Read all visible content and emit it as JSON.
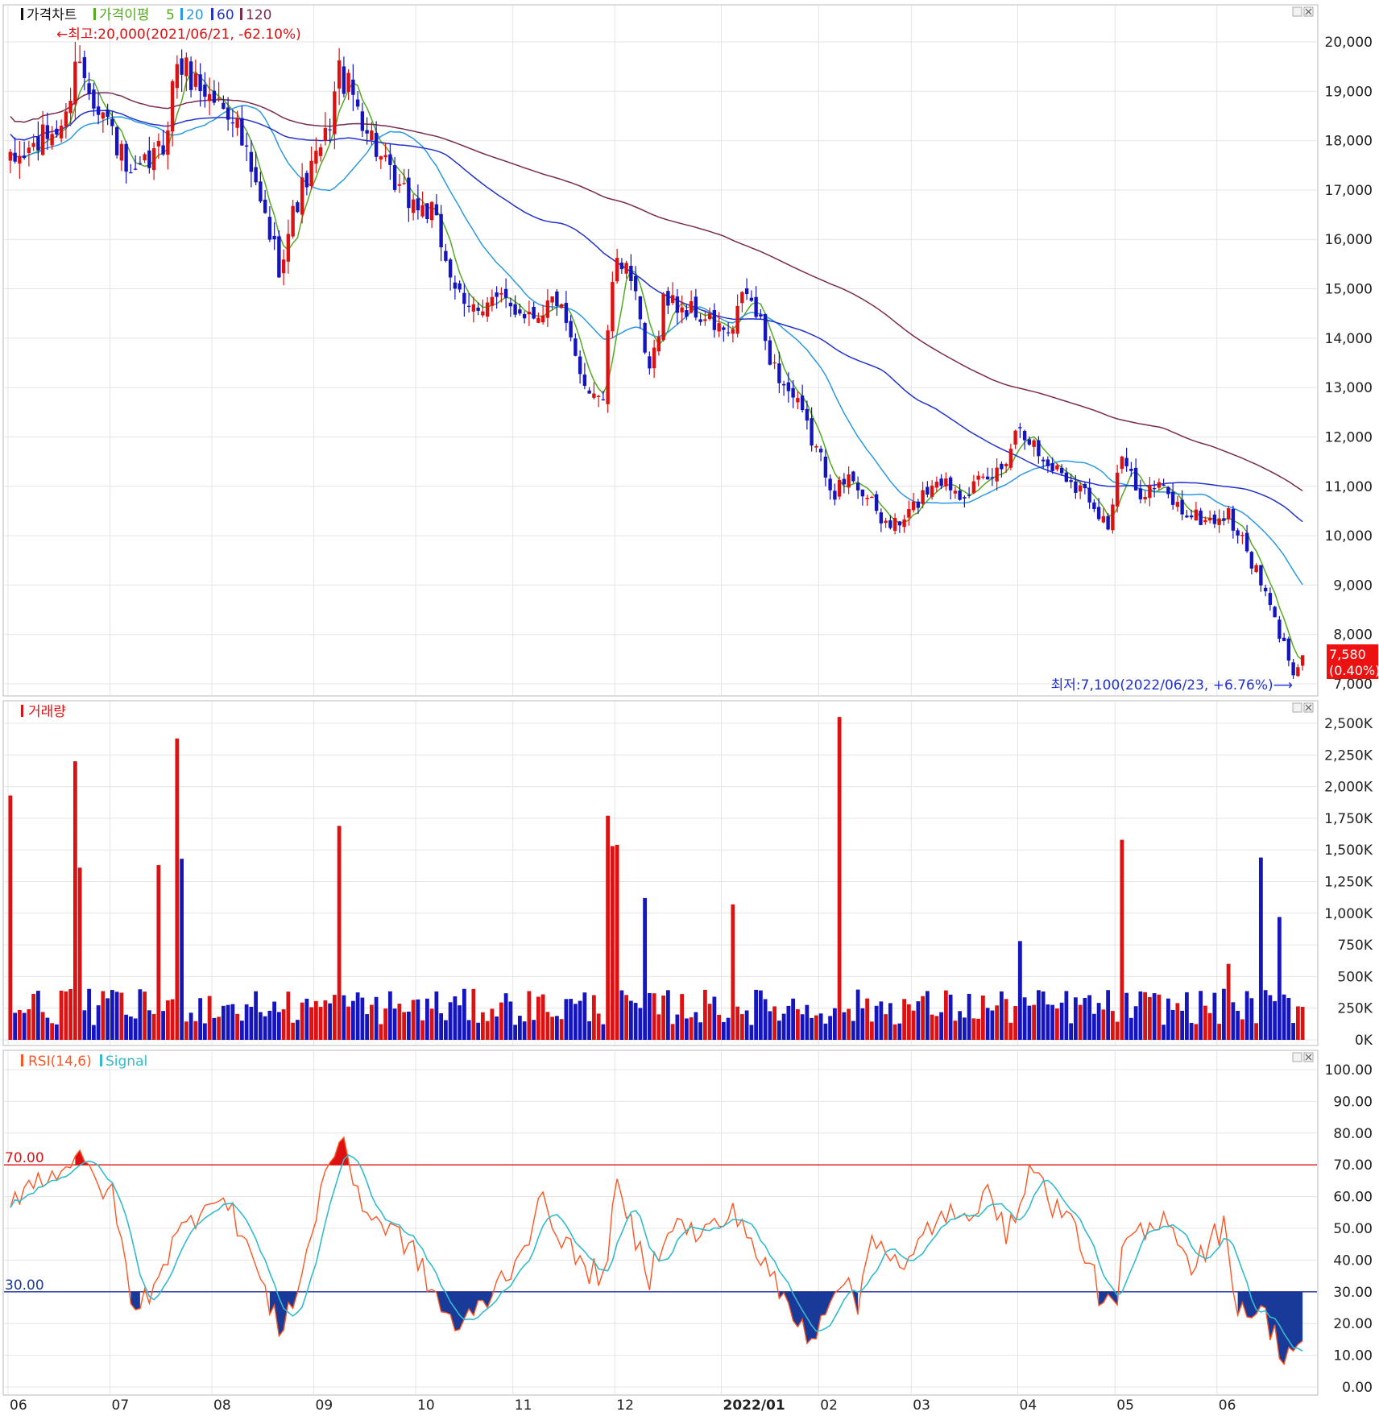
{
  "colors": {
    "up": "#dd1111",
    "down": "#1515c0",
    "ma5": "#55aa22",
    "ma20": "#2a9ae0",
    "ma60": "#2233cc",
    "ma120": "#7a2b4e",
    "rsi": "#ff5522",
    "signal": "#33bbcc",
    "overbought": "#dd1111",
    "oversold": "#1a3a9a",
    "grid": "#e4e4e4"
  },
  "price_panel": {
    "legend": {
      "title": "가격차트",
      "indicator": "가격이평",
      "ma5": "5",
      "ma20": "20",
      "ma60": "60",
      "ma120": "120"
    },
    "high_note": "←최고:20,000(2021/06/21, -62.10%)",
    "low_note": "최저:7,100(2022/06/23, +6.76%)⟶",
    "current_price": "7,580",
    "current_change": "(0.40%)"
  },
  "volume_panel": {
    "legend": "거래량"
  },
  "rsi_panel": {
    "legend_rsi": "RSI(14,6)",
    "legend_signal": "Signal",
    "level_high": "70.00",
    "level_low": "30.00"
  },
  "chart_data": [
    {
      "type": "candlestick",
      "panel": "price",
      "x_tick_labels": [
        "06",
        "07",
        "08",
        "09",
        "10",
        "11",
        "12",
        "2022/01",
        "02",
        "03",
        "04",
        "05",
        "06"
      ],
      "y_tick_labels": [
        "7,000",
        "8,000",
        "9,000",
        "10,000",
        "11,000",
        "12,000",
        "13,000",
        "14,000",
        "15,000",
        "16,000",
        "17,000",
        "18,000",
        "19,000",
        "20,000"
      ],
      "ylim": [
        6800,
        20600
      ],
      "session_count": 256,
      "ohlc_anchors": [
        {
          "date": "2021-06-01",
          "close": 17500
        },
        {
          "date": "2021-06-17",
          "close": 18400
        },
        {
          "date": "2021-06-21",
          "close": 19700
        },
        {
          "date": "2021-07-01",
          "close": 18200
        },
        {
          "date": "2021-07-07",
          "close": 17100
        },
        {
          "date": "2021-07-16",
          "close": 17900
        },
        {
          "date": "2021-07-21",
          "close": 19600
        },
        {
          "date": "2021-07-30",
          "close": 18900
        },
        {
          "date": "2021-08-06",
          "close": 18600
        },
        {
          "date": "2021-08-12",
          "close": 17300
        },
        {
          "date": "2021-08-20",
          "close": 15500
        },
        {
          "date": "2021-08-26",
          "close": 16800
        },
        {
          "date": "2021-09-03",
          "close": 18000
        },
        {
          "date": "2021-09-08",
          "close": 19400
        },
        {
          "date": "2021-09-14",
          "close": 18700
        },
        {
          "date": "2021-09-24",
          "close": 17000
        },
        {
          "date": "2021-10-06",
          "close": 16500
        },
        {
          "date": "2021-10-15",
          "close": 14500
        },
        {
          "date": "2021-10-22",
          "close": 14800
        },
        {
          "date": "2021-11-05",
          "close": 14500
        },
        {
          "date": "2021-11-12",
          "close": 14800
        },
        {
          "date": "2021-11-19",
          "close": 13200
        },
        {
          "date": "2021-11-26",
          "close": 12800
        },
        {
          "date": "2021-11-30",
          "close": 15200
        },
        {
          "date": "2021-12-03",
          "close": 15700
        },
        {
          "date": "2021-12-10",
          "close": 13200
        },
        {
          "date": "2021-12-15",
          "close": 14800
        },
        {
          "date": "2021-12-24",
          "close": 14500
        },
        {
          "date": "2022-01-05",
          "close": 14000
        },
        {
          "date": "2022-01-07",
          "close": 15000
        },
        {
          "date": "2022-01-12",
          "close": 14500
        },
        {
          "date": "2022-01-18",
          "close": 13400
        },
        {
          "date": "2022-01-25",
          "close": 12600
        },
        {
          "date": "2022-02-04",
          "close": 10900
        },
        {
          "date": "2022-02-10",
          "close": 11200
        },
        {
          "date": "2022-02-18",
          "close": 10300
        },
        {
          "date": "2022-02-24",
          "close": 10200
        },
        {
          "date": "2022-03-02",
          "close": 10700
        },
        {
          "date": "2022-03-08",
          "close": 11200
        },
        {
          "date": "2022-03-15",
          "close": 10900
        },
        {
          "date": "2022-03-23",
          "close": 11100
        },
        {
          "date": "2022-03-28",
          "close": 11400
        },
        {
          "date": "2022-04-01",
          "close": 12300
        },
        {
          "date": "2022-04-08",
          "close": 11500
        },
        {
          "date": "2022-04-14",
          "close": 11300
        },
        {
          "date": "2022-04-22",
          "close": 10800
        },
        {
          "date": "2022-04-28",
          "close": 10200
        },
        {
          "date": "2022-05-03",
          "close": 11600
        },
        {
          "date": "2022-05-06",
          "close": 10900
        },
        {
          "date": "2022-05-13",
          "close": 11000
        },
        {
          "date": "2022-05-20",
          "close": 10500
        },
        {
          "date": "2022-05-27",
          "close": 10300
        },
        {
          "date": "2022-06-03",
          "close": 10400
        },
        {
          "date": "2022-06-09",
          "close": 9700
        },
        {
          "date": "2022-06-15",
          "close": 8800
        },
        {
          "date": "2022-06-20",
          "close": 8000
        },
        {
          "date": "2022-06-23",
          "close": 7300
        },
        {
          "date": "2022-06-27",
          "close": 7580
        }
      ],
      "moving_averages": [
        {
          "name": "5",
          "period": 5
        },
        {
          "name": "20",
          "period": 20
        },
        {
          "name": "60",
          "period": 60
        },
        {
          "name": "120",
          "period": 120
        }
      ],
      "annotations": [
        {
          "text": "최고:20,000",
          "date": "2021-06-21",
          "value": 20000
        },
        {
          "text": "최저:7,100",
          "date": "2022-06-23",
          "value": 7100
        },
        {
          "text": "7,580",
          "value": 7580
        }
      ]
    },
    {
      "type": "bar",
      "panel": "volume",
      "y_tick_labels": [
        "0K",
        "250K",
        "500K",
        "750K",
        "1,000K",
        "1,250K",
        "1,500K",
        "1,750K",
        "2,000K",
        "2,250K",
        "2,500K"
      ],
      "ylim": [
        0,
        2600000
      ],
      "baseline": 260000,
      "spikes": [
        {
          "date": "2021-06-01",
          "value": 1930000
        },
        {
          "date": "2021-06-21",
          "value": 2200000
        },
        {
          "date": "2021-06-22",
          "value": 1360000
        },
        {
          "date": "2021-07-15",
          "value": 1380000
        },
        {
          "date": "2021-07-21",
          "value": 2380000
        },
        {
          "date": "2021-07-22",
          "value": 1430000
        },
        {
          "date": "2021-09-08",
          "value": 1690000
        },
        {
          "date": "2021-11-29",
          "value": 1770000
        },
        {
          "date": "2021-11-30",
          "value": 1530000
        },
        {
          "date": "2021-12-01",
          "value": 1540000
        },
        {
          "date": "2021-12-09",
          "value": 1120000
        },
        {
          "date": "2022-01-05",
          "value": 1070000
        },
        {
          "date": "2022-02-07",
          "value": 2550000
        },
        {
          "date": "2022-04-01",
          "value": 780000
        },
        {
          "date": "2022-05-03",
          "value": 1580000
        },
        {
          "date": "2022-06-03",
          "value": 600000
        },
        {
          "date": "2022-06-14",
          "value": 1440000
        },
        {
          "date": "2022-06-20",
          "value": 970000
        }
      ]
    },
    {
      "type": "line",
      "panel": "rsi",
      "series": [
        {
          "name": "RSI(14,6)"
        },
        {
          "name": "Signal"
        }
      ],
      "y_tick_labels": [
        "0.00",
        "10.00",
        "20.00",
        "30.00",
        "40.00",
        "50.00",
        "60.00",
        "70.00",
        "80.00",
        "90.00",
        "100.00"
      ],
      "ylim": [
        0,
        100
      ],
      "levels": [
        70,
        30
      ],
      "rsi_anchors": [
        {
          "date": "2021-06-01",
          "value": 60
        },
        {
          "date": "2021-06-21",
          "value": 72
        },
        {
          "date": "2021-07-01",
          "value": 60
        },
        {
          "date": "2021-07-08",
          "value": 22
        },
        {
          "date": "2021-07-20",
          "value": 45
        },
        {
          "date": "2021-08-02",
          "value": 62
        },
        {
          "date": "2021-08-10",
          "value": 50
        },
        {
          "date": "2021-08-18",
          "value": 25
        },
        {
          "date": "2021-08-20",
          "value": 18
        },
        {
          "date": "2021-08-27",
          "value": 35
        },
        {
          "date": "2021-09-03",
          "value": 68
        },
        {
          "date": "2021-09-08",
          "value": 78
        },
        {
          "date": "2021-09-16",
          "value": 55
        },
        {
          "date": "2021-09-29",
          "value": 45
        },
        {
          "date": "2021-10-08",
          "value": 25
        },
        {
          "date": "2021-10-14",
          "value": 18
        },
        {
          "date": "2021-10-22",
          "value": 28
        },
        {
          "date": "2021-11-01",
          "value": 40
        },
        {
          "date": "2021-11-09",
          "value": 58
        },
        {
          "date": "2021-11-19",
          "value": 38
        },
        {
          "date": "2021-11-26",
          "value": 35
        },
        {
          "date": "2021-12-01",
          "value": 62
        },
        {
          "date": "2021-12-10",
          "value": 35
        },
        {
          "date": "2021-12-16",
          "value": 52
        },
        {
          "date": "2021-12-27",
          "value": 48
        },
        {
          "date": "2022-01-06",
          "value": 55
        },
        {
          "date": "2022-01-13",
          "value": 40
        },
        {
          "date": "2022-01-25",
          "value": 20
        },
        {
          "date": "2022-01-28",
          "value": 16
        },
        {
          "date": "2022-02-07",
          "value": 35
        },
        {
          "date": "2022-02-11",
          "value": 25
        },
        {
          "date": "2022-02-16",
          "value": 50
        },
        {
          "date": "2022-02-25",
          "value": 35
        },
        {
          "date": "2022-03-04",
          "value": 50
        },
        {
          "date": "2022-03-10",
          "value": 55
        },
        {
          "date": "2022-03-17",
          "value": 50
        },
        {
          "date": "2022-03-23",
          "value": 68
        },
        {
          "date": "2022-03-29",
          "value": 45
        },
        {
          "date": "2022-04-05",
          "value": 70
        },
        {
          "date": "2022-04-12",
          "value": 58
        },
        {
          "date": "2022-04-19",
          "value": 50
        },
        {
          "date": "2022-04-26",
          "value": 30
        },
        {
          "date": "2022-05-02",
          "value": 22
        },
        {
          "date": "2022-05-03",
          "value": 45
        },
        {
          "date": "2022-05-13",
          "value": 50
        },
        {
          "date": "2022-05-17",
          "value": 55
        },
        {
          "date": "2022-05-24",
          "value": 38
        },
        {
          "date": "2022-05-31",
          "value": 48
        },
        {
          "date": "2022-06-02",
          "value": 50
        },
        {
          "date": "2022-06-07",
          "value": 26
        },
        {
          "date": "2022-06-15",
          "value": 22
        },
        {
          "date": "2022-06-21",
          "value": 10
        },
        {
          "date": "2022-06-27",
          "value": 15
        }
      ]
    }
  ]
}
